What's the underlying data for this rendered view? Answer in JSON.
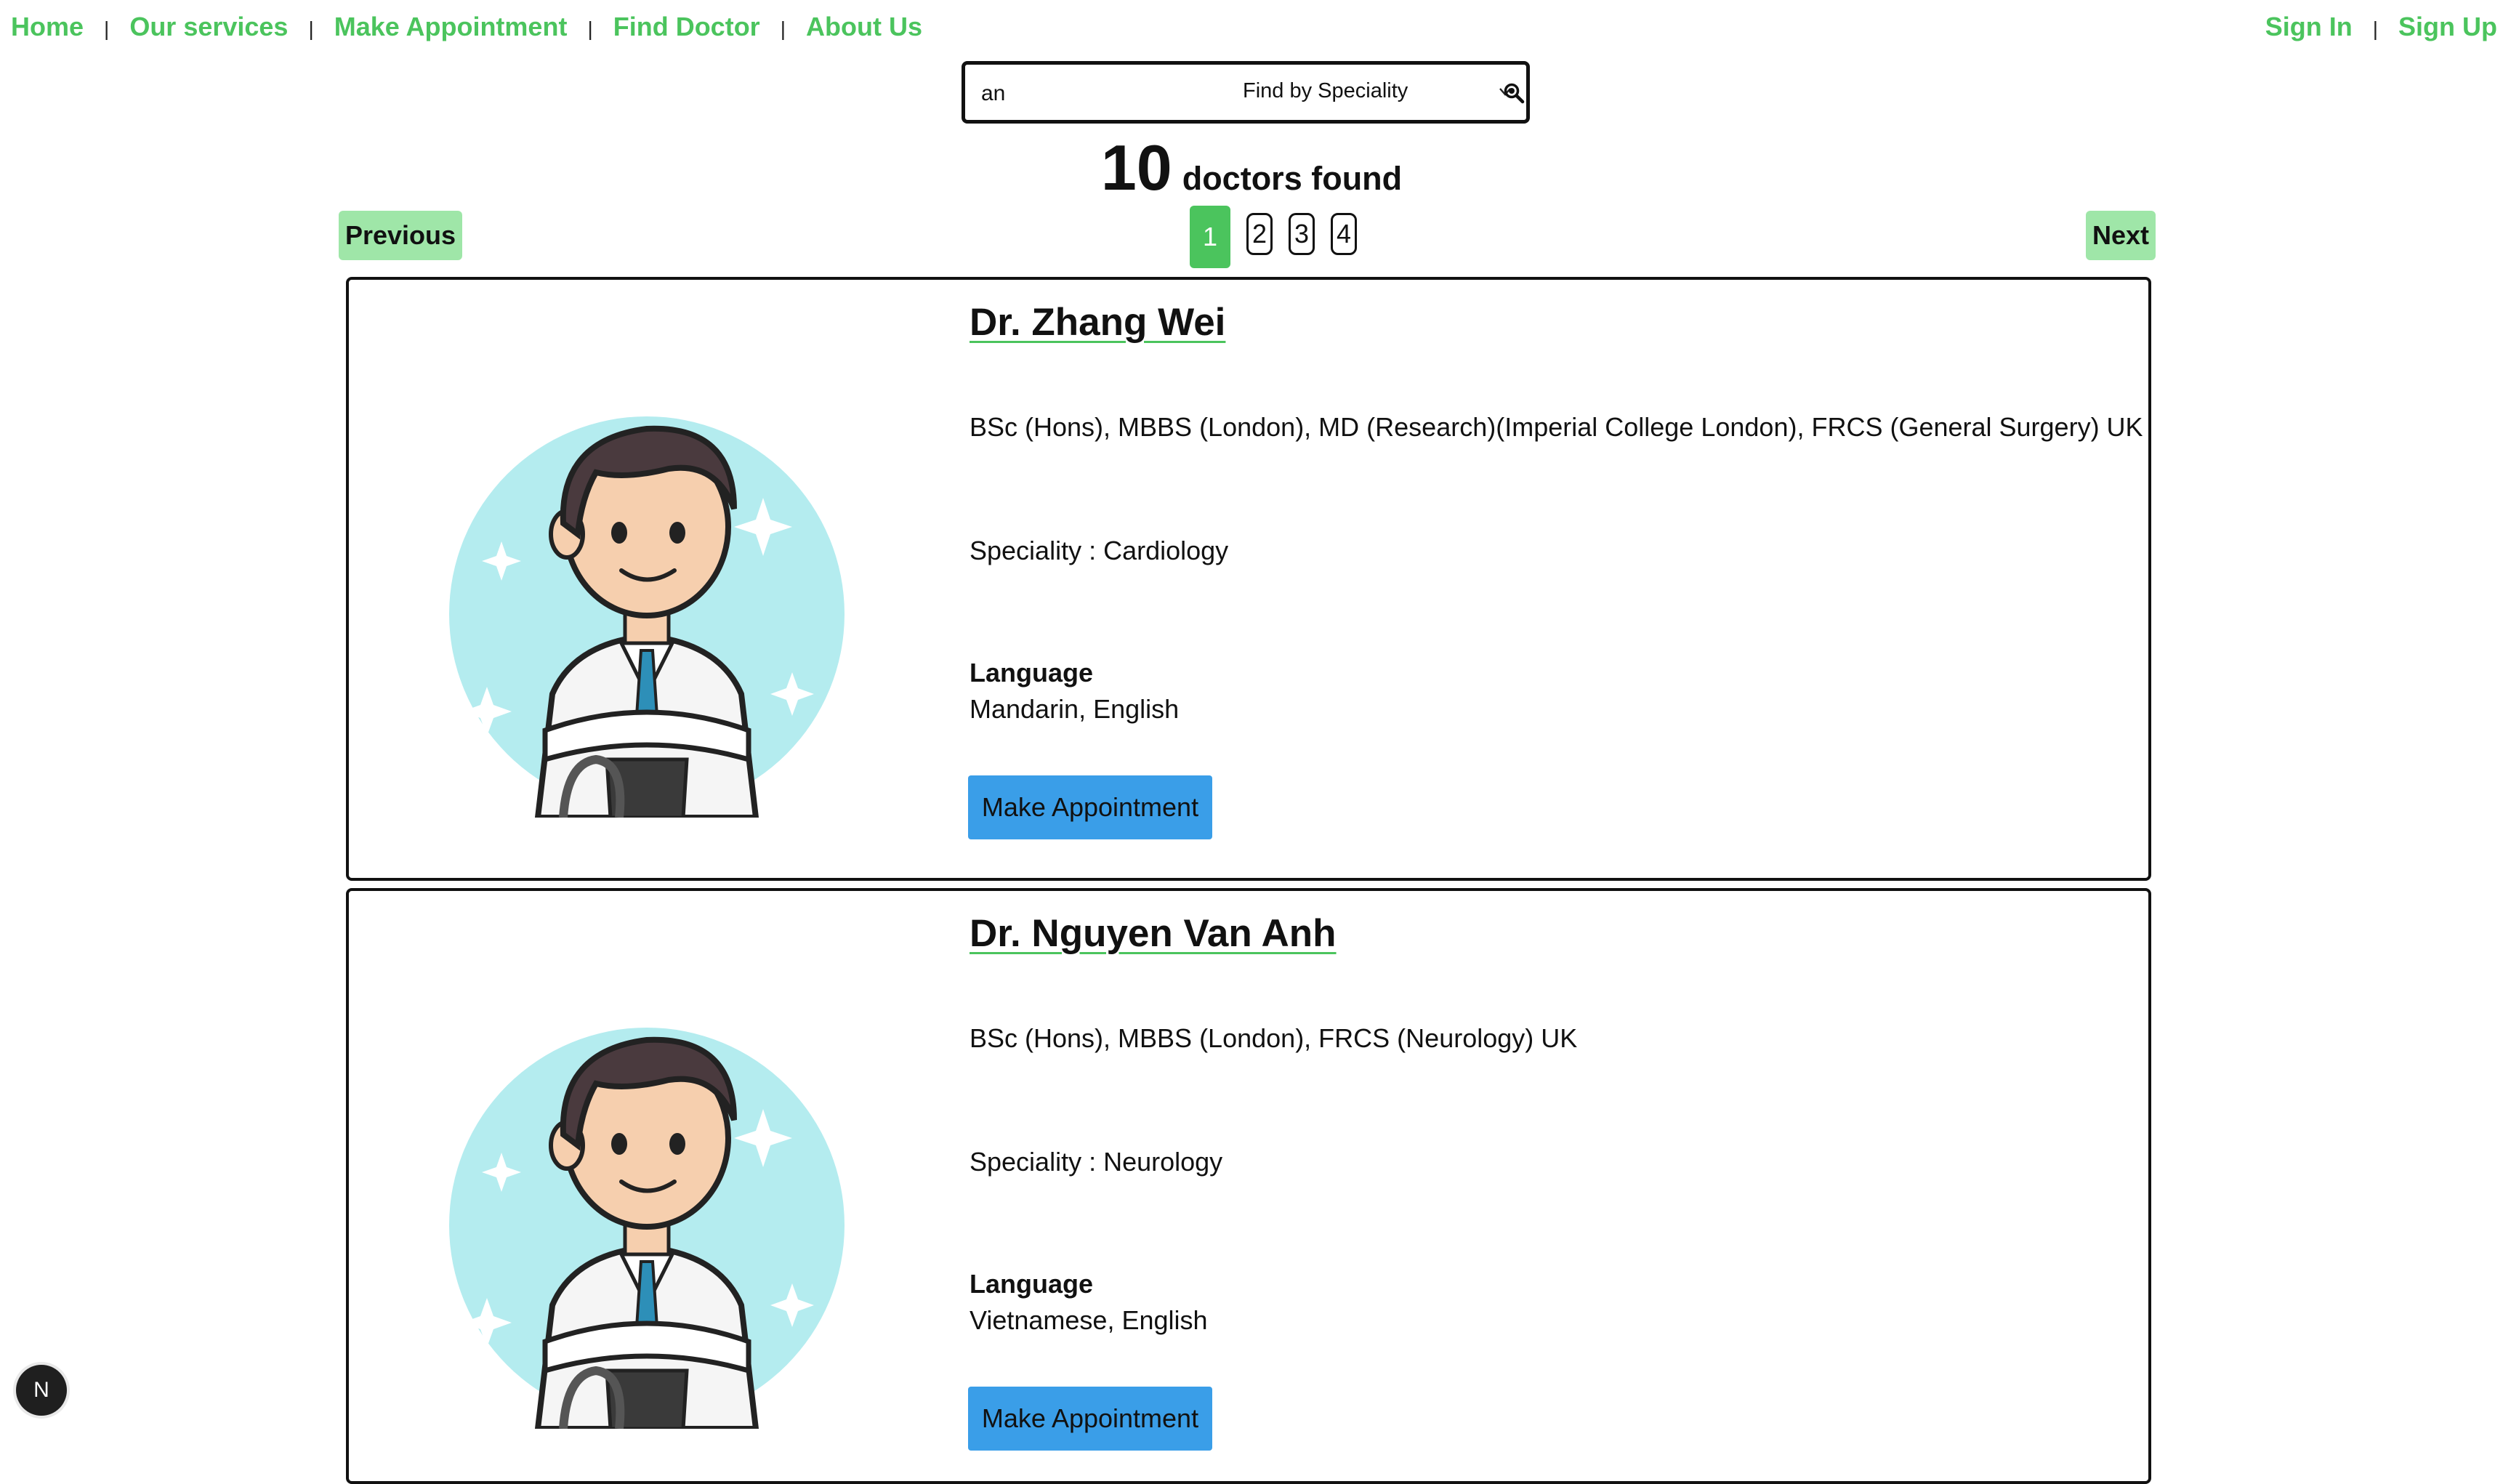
{
  "nav": {
    "left": [
      "Home",
      "Our services",
      "Make Appointment",
      "Find Doctor",
      "About Us"
    ],
    "separator": "|",
    "sign_in": "Sign In",
    "sign_up": "Sign Up"
  },
  "search": {
    "value": "an",
    "speciality_select": "Find by Speciality",
    "search_icon": "search-icon"
  },
  "results": {
    "count": "10",
    "label": "doctors found"
  },
  "pagination": {
    "previous": "Previous",
    "next": "Next",
    "pages": [
      "1",
      "2",
      "3",
      "4"
    ],
    "active_page": "1"
  },
  "doctors": [
    {
      "name": "Dr. Zhang Wei",
      "qualifications": "BSc (Hons), MBBS (London), MD (Research)(Imperial College London), FRCS (General Surgery) UK",
      "speciality": "Speciality : Cardiology",
      "language_heading": "Language",
      "languages": "Mandarin, English",
      "button": "Make Appointment"
    },
    {
      "name": "Dr. Nguyen Van Anh",
      "qualifications": "BSc (Hons), MBBS (London), FRCS (Neurology) UK",
      "speciality": "Speciality : Neurology",
      "language_heading": "Language",
      "languages": "Vietnamese, English",
      "button": "Make Appointment"
    }
  ],
  "dev_badge": "N",
  "colors": {
    "accent_green": "#4bc45d",
    "light_green": "#9fe6a8",
    "button_blue": "#3a9ee8",
    "avatar_circle": "#b4ecef"
  }
}
